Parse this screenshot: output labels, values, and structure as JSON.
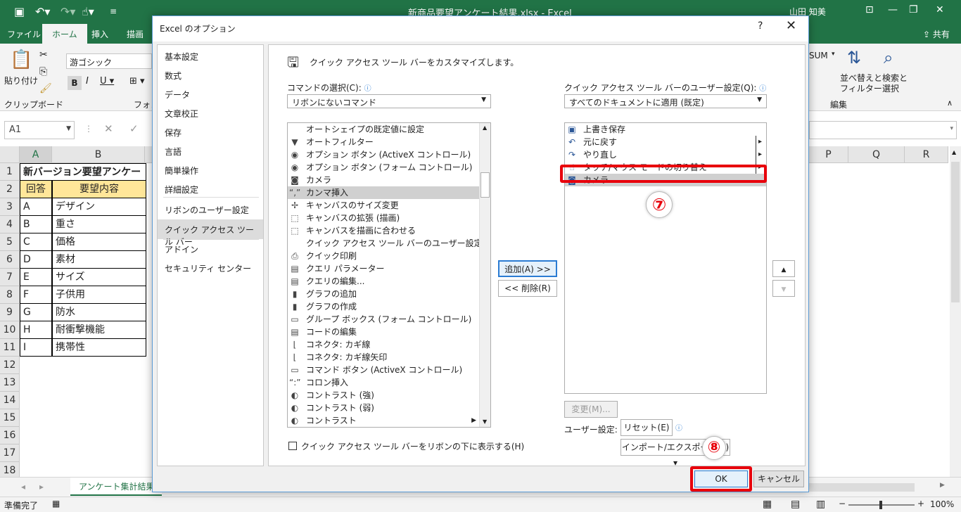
{
  "app": {
    "doc_title": "新商品要望アンケート結果.xlsx  -  Excel",
    "user": "山田 知美",
    "tabs": [
      "ファイル",
      "ホーム",
      "挿入",
      "描画"
    ],
    "share": "共有",
    "ribbon": {
      "paste": "貼り付け",
      "clipboard": "クリップボード",
      "font_name": "游ゴシック",
      "font_group": "フォン",
      "sum": "SUM",
      "sort_filter": "並べ替えと\nフィルター",
      "find_select": "検索と\n選択",
      "editing": "編集"
    },
    "name_box": "A1",
    "columns": [
      "A",
      "B",
      "P",
      "Q",
      "R"
    ],
    "rows": [
      "1",
      "2",
      "3",
      "4",
      "5",
      "6",
      "7",
      "8",
      "9",
      "10",
      "11",
      "12",
      "13",
      "14",
      "15",
      "16",
      "17",
      "18"
    ],
    "cells": {
      "title": "新バージョン要望アンケー",
      "header_a": "回答",
      "header_b": "要望内容",
      "data": [
        [
          "A",
          "デザイン"
        ],
        [
          "B",
          "重さ"
        ],
        [
          "C",
          "価格"
        ],
        [
          "D",
          "素材"
        ],
        [
          "E",
          "サイズ"
        ],
        [
          "F",
          "子供用"
        ],
        [
          "G",
          "防水"
        ],
        [
          "H",
          "耐衝撃機能"
        ],
        [
          "I",
          "携帯性"
        ]
      ]
    },
    "sheet_tab": "アンケート集計結果",
    "status": "準備完了",
    "zoom": "100%"
  },
  "dialog": {
    "title": "Excel のオプション",
    "help": "?",
    "nav": [
      "基本設定",
      "数式",
      "データ",
      "文章校正",
      "保存",
      "言語",
      "簡単操作",
      "詳細設定",
      "リボンのユーザー設定",
      "クイック アクセス ツール バー",
      "アドイン",
      "セキュリティ センター"
    ],
    "nav_selected": 9,
    "heading": "クイック アクセス ツール バーをカスタマイズします。",
    "choose_label": "コマンドの選択(C):",
    "choose_value": "リボンにないコマンド",
    "customize_label": "クイック アクセス ツール バーのユーザー設定(Q):",
    "customize_value": "すべてのドキュメントに適用 (既定)",
    "commands": [
      {
        "icon": "",
        "label": "オートシェイプの既定値に設定"
      },
      {
        "icon": "▼",
        "label": "オートフィルター"
      },
      {
        "icon": "◉",
        "label": "オプション ボタン (ActiveX コントロール)"
      },
      {
        "icon": "◉",
        "label": "オプション ボタン (フォーム コントロール)"
      },
      {
        "icon": "◙",
        "label": "カメラ"
      },
      {
        "icon": "“,”",
        "label": "カンマ挿入"
      },
      {
        "icon": "✢",
        "label": "キャンバスのサイズ変更"
      },
      {
        "icon": "⬚",
        "label": "キャンバスの拡張 (描画)"
      },
      {
        "icon": "⬚",
        "label": "キャンバスを描画に合わせる"
      },
      {
        "icon": "",
        "label": "クイック アクセス ツール バーのユーザー設定..."
      },
      {
        "icon": "⎙",
        "label": "クイック印刷"
      },
      {
        "icon": "▤",
        "label": "クエリ パラメーター"
      },
      {
        "icon": "▤",
        "label": "クエリの編集..."
      },
      {
        "icon": "▮",
        "label": "グラフの追加"
      },
      {
        "icon": "▮",
        "label": "グラフの作成"
      },
      {
        "icon": "▭",
        "label": "グループ ボックス (フォーム コントロール)"
      },
      {
        "icon": "▤",
        "label": "コードの編集"
      },
      {
        "icon": "⌊",
        "label": "コネクタ: カギ線"
      },
      {
        "icon": "⌊",
        "label": "コネクタ: カギ線矢印"
      },
      {
        "icon": "▭",
        "label": "コマンド ボタン (ActiveX コントロール)"
      },
      {
        "icon": "“:”",
        "label": "コロン挿入"
      },
      {
        "icon": "◐",
        "label": "コントラスト (強)"
      },
      {
        "icon": "◐",
        "label": "コントラスト (弱)"
      },
      {
        "icon": "◐",
        "label": "コントラスト"
      }
    ],
    "commands_selected": 5,
    "qat_items": [
      {
        "icon": "▣",
        "label": "上書き保存",
        "arrow": ""
      },
      {
        "icon": "↶",
        "label": "元に戻す",
        "arrow": "▸"
      },
      {
        "icon": "↷",
        "label": "やり直し",
        "arrow": "▸"
      },
      {
        "icon": "☝",
        "label": "タッチ/マウス モードの切り替え",
        "arrow": "▸"
      },
      {
        "icon": "◙",
        "label": "カメラ",
        "arrow": ""
      }
    ],
    "add_button": "追加(A) >>",
    "remove_button": "<< 削除(R)",
    "modify_button": "変更(M)...",
    "user_settings_label": "ユーザー設定:",
    "reset_button": "リセット(E) ▾",
    "import_export_button": "インポート/エクスポート(P) ▾",
    "show_below_label": "クイック アクセス ツール バーをリボンの下に表示する(H)",
    "ok_button": "OK",
    "cancel_button": "キャンセル",
    "step7": "⑦",
    "step8": "⑧"
  }
}
